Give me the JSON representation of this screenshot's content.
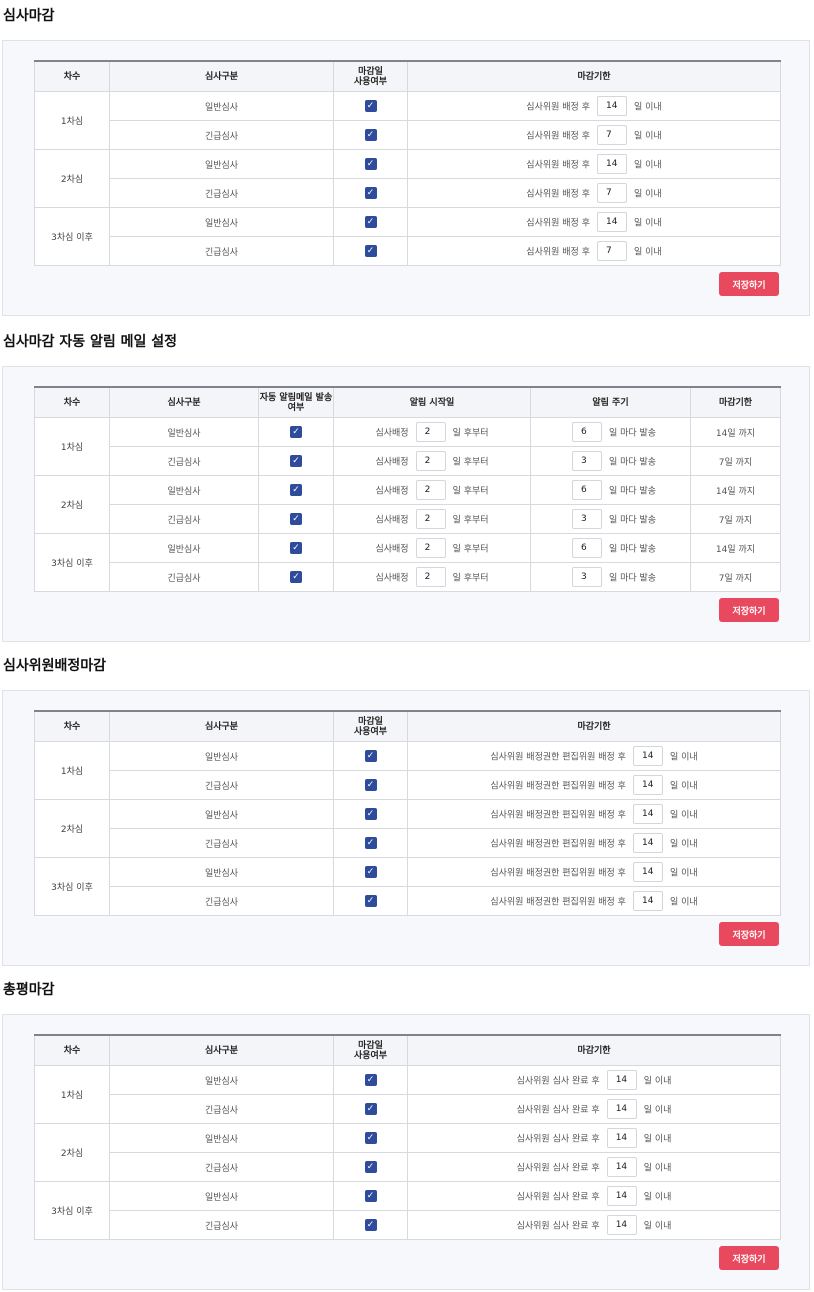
{
  "review_deadline": {
    "title": "심사마감",
    "headers": [
      "차수",
      "심사구분",
      "마감일\n사용여부",
      "마감기한"
    ],
    "rows": [
      {
        "round": "1차심",
        "type": "일반심사",
        "prefix": "심사위원 배정 후",
        "value": "14",
        "suffix": "일 이내"
      },
      {
        "type": "긴급심사",
        "prefix": "심사위원 배정 후",
        "value": "7",
        "suffix": "일 이내"
      },
      {
        "round": "2차심",
        "type": "일반심사",
        "prefix": "심사위원 배정 후",
        "value": "14",
        "suffix": "일 이내"
      },
      {
        "type": "긴급심사",
        "prefix": "심사위원 배정 후",
        "value": "7",
        "suffix": "일 이내"
      },
      {
        "round": "3차심 이후",
        "type": "일반심사",
        "prefix": "심사위원 배정 후",
        "value": "14",
        "suffix": "일 이내"
      },
      {
        "type": "긴급심사",
        "prefix": "심사위원 배정 후",
        "value": "7",
        "suffix": "일 이내"
      }
    ],
    "save_label": "저장하기"
  },
  "auto_mail": {
    "title": "심사마감 자동 알림 메일 설정",
    "headers": [
      "차수",
      "심사구분",
      "자동 알림메일 발송\n여부",
      "알림 시작일",
      "알림 주기",
      "마감기한"
    ],
    "rows": [
      {
        "round": "1차심",
        "type": "일반심사",
        "start_prefix": "심사배정",
        "start": "2",
        "start_suffix": "일 후부터",
        "cycle": "6",
        "cycle_suffix": "일 마다 발송",
        "deadline": "14일 까지"
      },
      {
        "type": "긴급심사",
        "start_prefix": "심사배정",
        "start": "2",
        "start_suffix": "일 후부터",
        "cycle": "3",
        "cycle_suffix": "일 마다 발송",
        "deadline": "7일 까지"
      },
      {
        "round": "2차심",
        "type": "일반심사",
        "start_prefix": "심사배정",
        "start": "2",
        "start_suffix": "일 후부터",
        "cycle": "6",
        "cycle_suffix": "일 마다 발송",
        "deadline": "14일 까지"
      },
      {
        "type": "긴급심사",
        "start_prefix": "심사배정",
        "start": "2",
        "start_suffix": "일 후부터",
        "cycle": "3",
        "cycle_suffix": "일 마다 발송",
        "deadline": "7일 까지"
      },
      {
        "round": "3차심 이후",
        "type": "일반심사",
        "start_prefix": "심사배정",
        "start": "2",
        "start_suffix": "일 후부터",
        "cycle": "6",
        "cycle_suffix": "일 마다 발송",
        "deadline": "14일 까지"
      },
      {
        "type": "긴급심사",
        "start_prefix": "심사배정",
        "start": "2",
        "start_suffix": "일 후부터",
        "cycle": "3",
        "cycle_suffix": "일 마다 발송",
        "deadline": "7일 까지"
      }
    ],
    "save_label": "저장하기"
  },
  "assign_deadline": {
    "title": "심사위원배정마감",
    "headers": [
      "차수",
      "심사구분",
      "마감일\n사용여부",
      "마감기한"
    ],
    "rows": [
      {
        "round": "1차심",
        "type": "일반심사",
        "prefix": "심사위원 배정권한 편집위원 배정 후",
        "value": "14",
        "suffix": "일 이내"
      },
      {
        "type": "긴급심사",
        "prefix": "심사위원 배정권한 편집위원 배정 후",
        "value": "14",
        "suffix": "일 이내"
      },
      {
        "round": "2차심",
        "type": "일반심사",
        "prefix": "심사위원 배정권한 편집위원 배정 후",
        "value": "14",
        "suffix": "일 이내"
      },
      {
        "type": "긴급심사",
        "prefix": "심사위원 배정권한 편집위원 배정 후",
        "value": "14",
        "suffix": "일 이내"
      },
      {
        "round": "3차심 이후",
        "type": "일반심사",
        "prefix": "심사위원 배정권한 편집위원 배정 후",
        "value": "14",
        "suffix": "일 이내"
      },
      {
        "type": "긴급심사",
        "prefix": "심사위원 배정권한 편집위원 배정 후",
        "value": "14",
        "suffix": "일 이내"
      }
    ],
    "save_label": "저장하기"
  },
  "summary_deadline": {
    "title": "총평마감",
    "headers": [
      "차수",
      "심사구분",
      "마감일\n사용여부",
      "마감기한"
    ],
    "rows": [
      {
        "round": "1차심",
        "type": "일반심사",
        "prefix": "심사위원 심사 완료 후",
        "value": "14",
        "suffix": "일 이내"
      },
      {
        "type": "긴급심사",
        "prefix": "심사위원 심사 완료 후",
        "value": "14",
        "suffix": "일 이내"
      },
      {
        "round": "2차심",
        "type": "일반심사",
        "prefix": "심사위원 심사 완료 후",
        "value": "14",
        "suffix": "일 이내"
      },
      {
        "type": "긴급심사",
        "prefix": "심사위원 심사 완료 후",
        "value": "14",
        "suffix": "일 이내"
      },
      {
        "round": "3차심 이후",
        "type": "일반심사",
        "prefix": "심사위원 심사 완료 후",
        "value": "14",
        "suffix": "일 이내"
      },
      {
        "type": "긴급심사",
        "prefix": "심사위원 심사 완료 후",
        "value": "14",
        "suffix": "일 이내"
      }
    ],
    "save_label": "저장하기"
  }
}
